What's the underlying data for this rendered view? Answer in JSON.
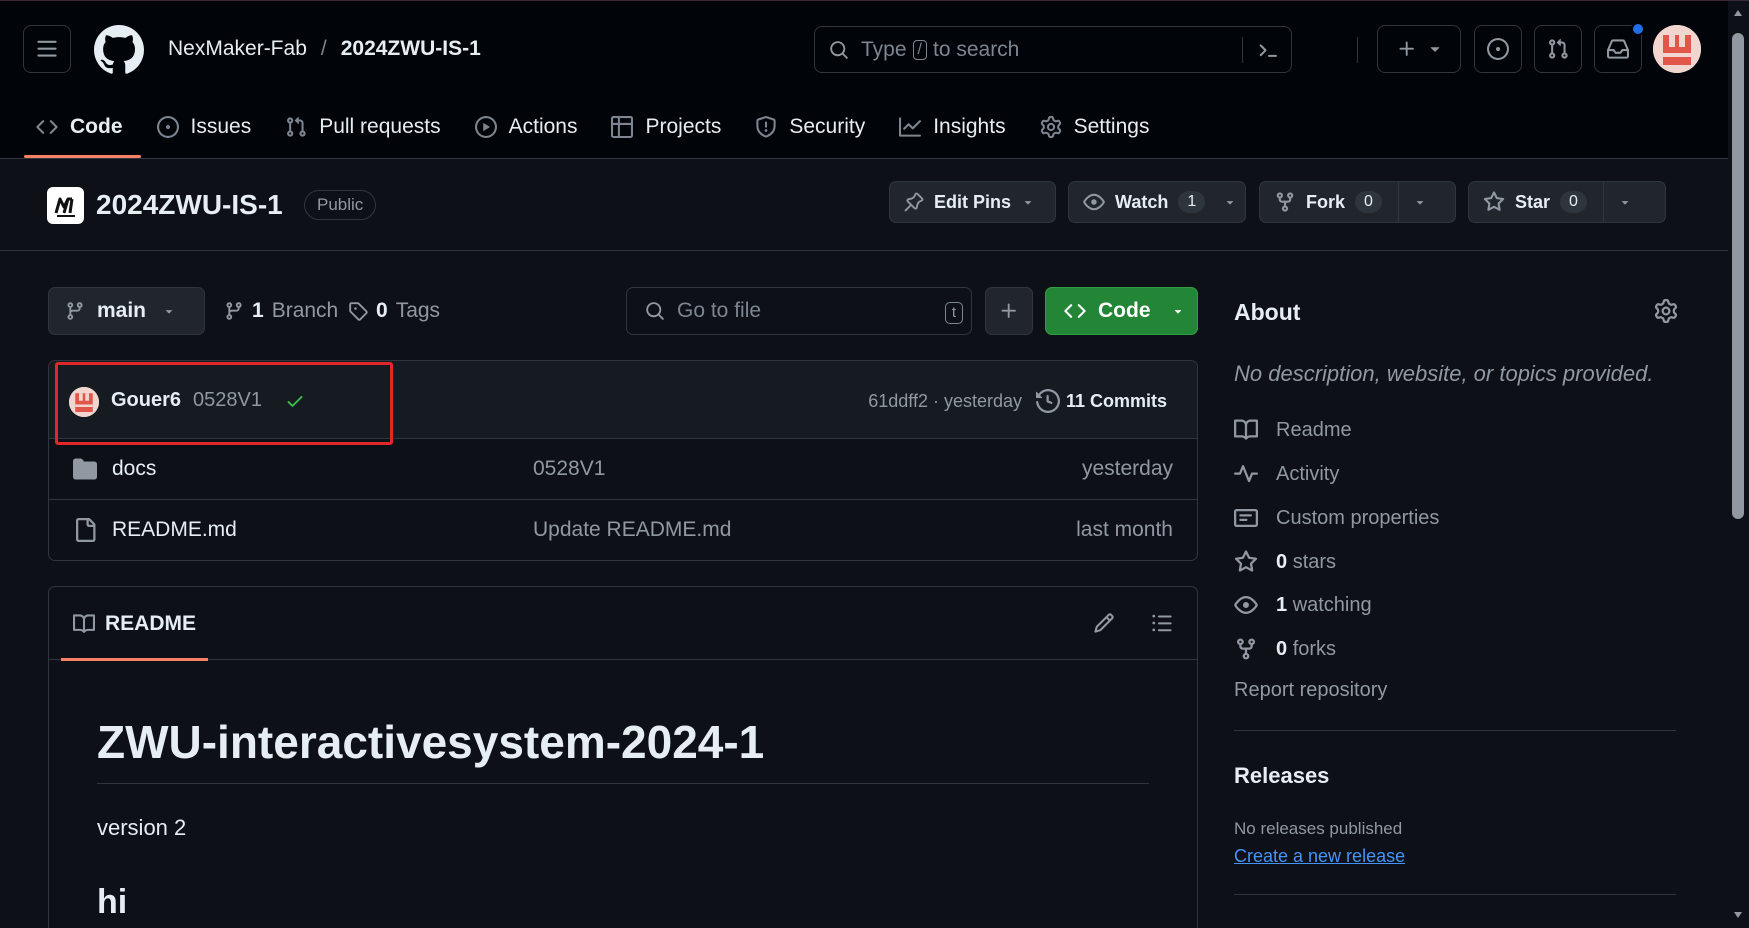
{
  "header": {
    "owner": "NexMaker-Fab",
    "separator": "/",
    "repo": "2024ZWU-IS-1",
    "search": {
      "prefix": "Type",
      "key": "/",
      "suffix": "to search"
    }
  },
  "tabs": [
    {
      "label": "Code",
      "icon": "code-icon"
    },
    {
      "label": "Issues",
      "icon": "issue-icon"
    },
    {
      "label": "Pull requests",
      "icon": "pull-request-icon"
    },
    {
      "label": "Actions",
      "icon": "play-icon"
    },
    {
      "label": "Projects",
      "icon": "table-icon"
    },
    {
      "label": "Security",
      "icon": "shield-icon"
    },
    {
      "label": "Insights",
      "icon": "graph-icon"
    },
    {
      "label": "Settings",
      "icon": "gear-icon"
    }
  ],
  "repo": {
    "name": "2024ZWU-IS-1",
    "visibility": "Public",
    "edit_pins": "Edit Pins",
    "watch": {
      "label": "Watch",
      "count": "1"
    },
    "fork": {
      "label": "Fork",
      "count": "0"
    },
    "star": {
      "label": "Star",
      "count": "0"
    }
  },
  "toolbar": {
    "branch": "main",
    "branches_count": "1",
    "branches_label": "Branch",
    "tags_count": "0",
    "tags_label": "Tags",
    "goto_placeholder": "Go to file",
    "goto_key": "t",
    "code_label": "Code"
  },
  "commit": {
    "author": "Gouer6",
    "message": "0528V1",
    "hash_time": "61ddff2 · yesterday",
    "commits_label": "11 Commits"
  },
  "files": [
    {
      "name": "docs",
      "type": "folder",
      "message": "0528V1",
      "date": "yesterday"
    },
    {
      "name": "README.md",
      "type": "file",
      "message": "Update README.md",
      "date": "last month"
    }
  ],
  "readme": {
    "tab_label": "README",
    "h1": "ZWU-interactivesystem-2024-1",
    "paragraph": "version 2",
    "h2": "hi"
  },
  "about": {
    "title": "About",
    "description": "No description, website, or topics provided.",
    "items": [
      {
        "label": "Readme",
        "icon": "book-icon"
      },
      {
        "label": "Activity",
        "icon": "pulse-icon"
      },
      {
        "label": "Custom properties",
        "icon": "note-icon"
      },
      {
        "count": "0",
        "label": "stars",
        "icon": "star-icon"
      },
      {
        "count": "1",
        "label": "watching",
        "icon": "eye-icon"
      },
      {
        "count": "0",
        "label": "forks",
        "icon": "fork-icon"
      }
    ],
    "report": "Report repository"
  },
  "releases": {
    "title": "Releases",
    "none": "No releases published",
    "create": "Create a new release"
  },
  "colors": {
    "background": "#0d1117",
    "header": "#010409",
    "accent_underline": "#f78166",
    "primary_button": "#238636",
    "link": "#4493f8",
    "highlight_box": "#e0282a"
  }
}
